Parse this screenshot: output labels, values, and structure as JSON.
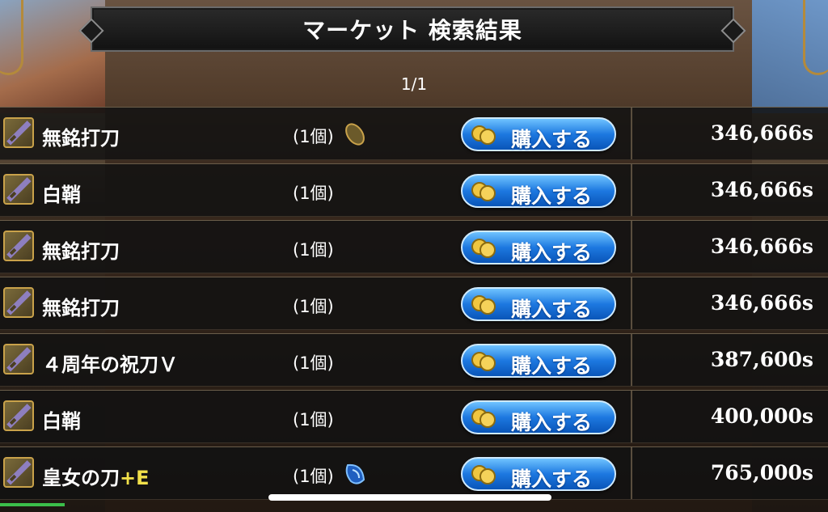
{
  "header": {
    "title": "マーケット 検索結果"
  },
  "pagination": {
    "text": "1/1"
  },
  "rows": [
    {
      "name": "無銘打刀",
      "suffix": "",
      "qty": "(1個)",
      "badge": "seed-icon",
      "buy_label": "購入する",
      "price": "346,666s"
    },
    {
      "name": "白鞘",
      "suffix": "",
      "qty": "(1個)",
      "badge": "",
      "buy_label": "購入する",
      "price": "346,666s"
    },
    {
      "name": "無銘打刀",
      "suffix": "",
      "qty": "(1個)",
      "badge": "",
      "buy_label": "購入する",
      "price": "346,666s"
    },
    {
      "name": "無銘打刀",
      "suffix": "",
      "qty": "(1個)",
      "badge": "",
      "buy_label": "購入する",
      "price": "346,666s"
    },
    {
      "name": "４周年の祝刀Ｖ",
      "suffix": "",
      "qty": "(1個)",
      "badge": "",
      "buy_label": "購入する",
      "price": "387,600s"
    },
    {
      "name": "白鞘",
      "suffix": "",
      "qty": "(1個)",
      "badge": "",
      "buy_label": "購入する",
      "price": "400,000s"
    },
    {
      "name": "皇女の刀",
      "suffix": "+E",
      "qty": "(1個)",
      "badge": "water-drop-icon",
      "buy_label": "購入する",
      "price": "765,000s"
    }
  ],
  "colors": {
    "accent_gold": "#c9a24a",
    "button_blue": "#1d78e0",
    "suffix_yellow": "#f2e04a"
  }
}
